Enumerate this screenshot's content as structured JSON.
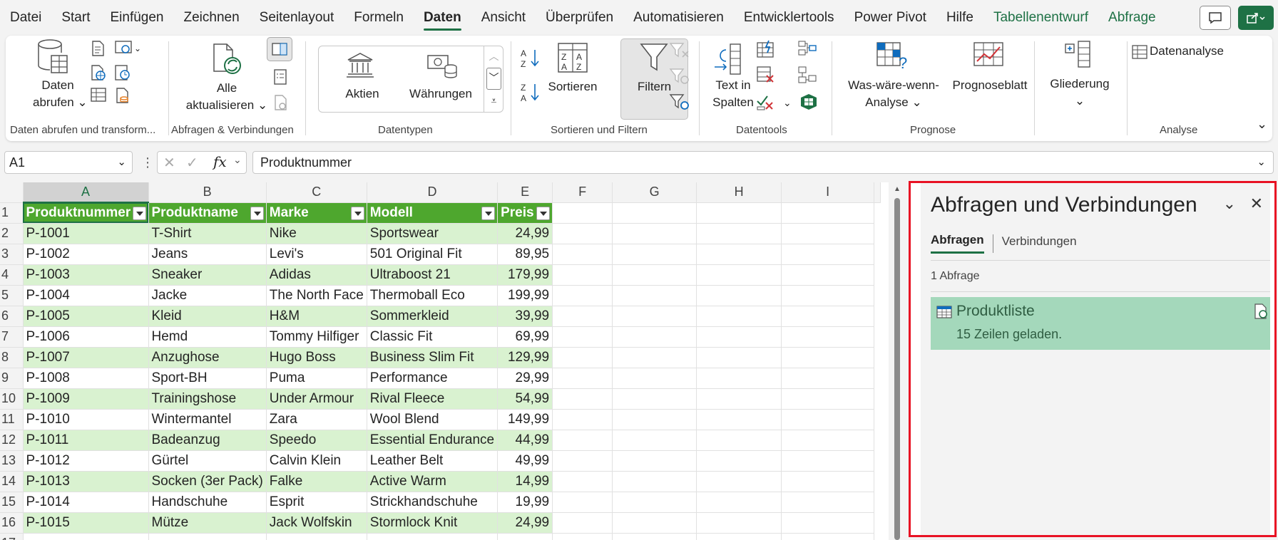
{
  "menu": {
    "items": [
      "Datei",
      "Start",
      "Einfügen",
      "Zeichnen",
      "Seitenlayout",
      "Formeln",
      "Daten",
      "Ansicht",
      "Überprüfen",
      "Automatisieren",
      "Entwicklertools",
      "Power Pivot",
      "Hilfe",
      "Tabellenentwurf",
      "Abfrage"
    ],
    "active": "Daten"
  },
  "ribbon": {
    "get_data": {
      "label1": "Daten",
      "label2": "abrufen"
    },
    "refresh_all": {
      "label1": "Alle",
      "label2": "aktualisieren"
    },
    "stocks": "Aktien",
    "currencies": "Währungen",
    "sort": "Sortieren",
    "filter": "Filtern",
    "text_to_columns": {
      "label1": "Text in",
      "label2": "Spalten"
    },
    "what_if": {
      "label1": "Was-wäre-wenn-",
      "label2": "Analyse"
    },
    "forecast_sheet": "Prognoseblatt",
    "outline": "Gliederung",
    "data_analysis": "Datenanalyse",
    "groups": {
      "get_transform": "Daten abrufen und transform...",
      "queries_connections": "Abfragen & Verbindungen",
      "data_types": "Datentypen",
      "sort_filter": "Sortieren und Filtern",
      "data_tools": "Datentools",
      "forecast": "Prognose",
      "analysis": "Analyse"
    }
  },
  "formula_bar": {
    "name_box": "A1",
    "formula": "Produktnummer",
    "fx": "fx"
  },
  "sheet": {
    "columns": [
      "A",
      "B",
      "C",
      "D",
      "E",
      "F",
      "G",
      "H",
      "I"
    ],
    "headers": [
      "Produktnummer",
      "Produktname",
      "Marke",
      "Modell",
      "Preis"
    ],
    "rows": [
      [
        "P-1001",
        "T-Shirt",
        "Nike",
        "Sportswear",
        "24,99"
      ],
      [
        "P-1002",
        "Jeans",
        "Levi's",
        "501 Original Fit",
        "89,95"
      ],
      [
        "P-1003",
        "Sneaker",
        "Adidas",
        "Ultraboost 21",
        "179,99"
      ],
      [
        "P-1004",
        "Jacke",
        "The North Face",
        "Thermoball Eco",
        "199,99"
      ],
      [
        "P-1005",
        "Kleid",
        "H&M",
        "Sommerkleid",
        "39,99"
      ],
      [
        "P-1006",
        "Hemd",
        "Tommy Hilfiger",
        "Classic Fit",
        "69,99"
      ],
      [
        "P-1007",
        "Anzughose",
        "Hugo Boss",
        "Business Slim Fit",
        "129,99"
      ],
      [
        "P-1008",
        "Sport-BH",
        "Puma",
        "Performance",
        "29,99"
      ],
      [
        "P-1009",
        "Trainingshose",
        "Under Armour",
        "Rival Fleece",
        "54,99"
      ],
      [
        "P-1010",
        "Wintermantel",
        "Zara",
        "Wool Blend",
        "149,99"
      ],
      [
        "P-1011",
        "Badeanzug",
        "Speedo",
        "Essential Endurance",
        "44,99"
      ],
      [
        "P-1012",
        "Gürtel",
        "Calvin Klein",
        "Leather Belt",
        "49,99"
      ],
      [
        "P-1013",
        "Socken (3er Pack)",
        "Falke",
        "Active Warm",
        "14,99"
      ],
      [
        "P-1014",
        "Handschuhe",
        "Esprit",
        "Strickhandschuhe",
        "19,99"
      ],
      [
        "P-1015",
        "Mütze",
        "Jack Wolfskin",
        "Stormlock Knit",
        "24,99"
      ]
    ]
  },
  "pane": {
    "title": "Abfragen und Verbindungen",
    "tab_queries": "Abfragen",
    "tab_connections": "Verbindungen",
    "count": "1 Abfrage",
    "query_name": "Produktliste",
    "query_status": "15 Zeilen geladen."
  },
  "colors": {
    "accent": "#1e7145",
    "table_header": "#4ea72e",
    "band": "#d9f2d0",
    "query_card": "#a4d8bb",
    "highlight_border": "#e81224"
  }
}
